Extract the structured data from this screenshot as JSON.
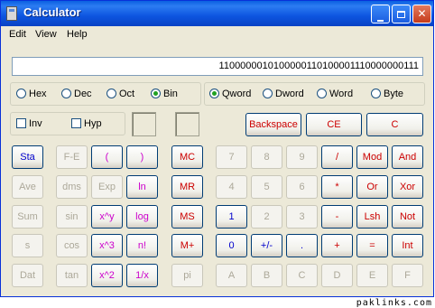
{
  "window": {
    "title": "Calculator",
    "min_icon": "minimize-icon",
    "max_icon": "maximize-icon",
    "close_icon": "close-icon"
  },
  "menu": [
    "Edit",
    "View",
    "Help"
  ],
  "display": {
    "value": "1100000010100000110100001110000000111"
  },
  "bases": [
    {
      "label": "Hex",
      "selected": false
    },
    {
      "label": "Dec",
      "selected": false
    },
    {
      "label": "Oct",
      "selected": false
    },
    {
      "label": "Bin",
      "selected": true
    }
  ],
  "words": [
    {
      "label": "Qword",
      "selected": true
    },
    {
      "label": "Dword",
      "selected": false
    },
    {
      "label": "Word",
      "selected": false
    },
    {
      "label": "Byte",
      "selected": false
    }
  ],
  "flags": {
    "inv": "Inv",
    "hyp": "Hyp"
  },
  "edit_buttons": {
    "backspace": "Backspace",
    "ce": "CE",
    "c": "C"
  },
  "keys": {
    "sta": "Sta",
    "ave": "Ave",
    "sum": "Sum",
    "s": "s",
    "dat": "Dat",
    "fe": "F-E",
    "dms": "dms",
    "sin": "sin",
    "cos": "cos",
    "tan": "tan",
    "lparen": "(",
    "rparen": ")",
    "exp": "Exp",
    "ln": "ln",
    "xy": "x^y",
    "log": "log",
    "x3": "x^3",
    "nfact": "n!",
    "x2": "x^2",
    "recip": "1/x",
    "mc": "MC",
    "mr": "MR",
    "ms": "MS",
    "mplus": "M+",
    "pi": "pi",
    "d7": "7",
    "d8": "8",
    "d9": "9",
    "div": "/",
    "mod": "Mod",
    "and": "And",
    "d4": "4",
    "d5": "5",
    "d6": "6",
    "mul": "*",
    "or": "Or",
    "xor": "Xor",
    "d1": "1",
    "d2": "2",
    "d3": "3",
    "sub": "-",
    "lsh": "Lsh",
    "not": "Not",
    "d0": "0",
    "sign": "+/-",
    "dot": ".",
    "add": "+",
    "eq": "=",
    "int": "Int",
    "hA": "A",
    "hB": "B",
    "hC": "C",
    "hD": "D",
    "hE": "E",
    "hF": "F"
  },
  "watermark": "paklinks.com"
}
